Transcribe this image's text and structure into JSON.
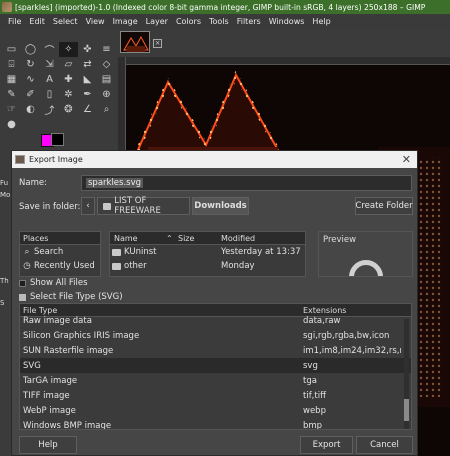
{
  "window": {
    "title": "[sparkles] (imported)-1.0 (Indexed color 8-bit gamma integer, GIMP built-in sRGB, 4 layers) 250x188 – GIMP"
  },
  "menu": [
    "File",
    "Edit",
    "Select",
    "View",
    "Image",
    "Layer",
    "Colors",
    "Tools",
    "Filters",
    "Windows",
    "Help"
  ],
  "toolbox": {
    "tools": [
      "rect-select-icon",
      "ellipse-select-icon",
      "lasso-icon",
      "fuzzy-select-icon",
      "move-icon",
      "align-icon",
      "crop-icon",
      "rotate-icon",
      "scale-icon",
      "shear-icon",
      "flip-icon",
      "perspective-icon",
      "cage-icon",
      "warp-icon",
      "text-icon",
      "heal-icon",
      "bucket-icon",
      "gradient-icon",
      "pencil-icon",
      "brush-icon",
      "eraser-icon",
      "airbrush-icon",
      "ink-icon",
      "clone-icon",
      "smudge-icon",
      "dodge-icon",
      "path-icon",
      "color-picker-icon",
      "measure-icon",
      "zoom-icon",
      "blur-icon"
    ],
    "tool_glyphs": [
      "▭",
      "◯",
      "⌒",
      "✧",
      "✜",
      "≡",
      "⌹",
      "↻",
      "⇲",
      "▱",
      "⇄",
      "◇",
      "▦",
      "∿",
      "A",
      "✚",
      "◣",
      "▤",
      "✎",
      "✐",
      "▯",
      "✲",
      "✒",
      "⊕",
      "☞",
      "◐",
      "⤴",
      "❂",
      "∠",
      "⌕",
      "●"
    ],
    "side_labels": [
      "Fu",
      "Mo",
      "Th",
      "S"
    ],
    "colors": {
      "foreground": "#ff00ff",
      "background": "#000000"
    }
  },
  "dialog": {
    "title": "Export Image",
    "name_label": "Name:",
    "name_value": "sparkles.svg",
    "save_in_label": "Save in folder:",
    "breadcrumb": [
      "LIST OF FREEWARE",
      "Downloads"
    ],
    "create_folder": "Create Folder",
    "places": {
      "header": "Places",
      "items": [
        {
          "icon": "search-icon",
          "label": "Search"
        },
        {
          "icon": "recent-icon",
          "label": "Recently Used"
        }
      ]
    },
    "files": {
      "columns": [
        "Name",
        "Size",
        "Modified"
      ],
      "rows": [
        {
          "name": "KUninst",
          "size": "",
          "modified": "Yesterday at 13:37"
        },
        {
          "name": "other",
          "size": "",
          "modified": "Monday"
        }
      ]
    },
    "preview_label": "Preview",
    "show_all_files": "Show All Files",
    "select_file_type": "Select File Type (SVG)",
    "filetypes": {
      "columns": [
        "File Type",
        "Extensions"
      ],
      "rows": [
        {
          "type": "Raw image data",
          "ext": "data,raw"
        },
        {
          "type": "Silicon Graphics IRIS image",
          "ext": "sgi,rgb,rgba,bw,icon"
        },
        {
          "type": "SUN Rasterfile image",
          "ext": "im1,im8,im24,im32,rs,ras"
        },
        {
          "type": "SVG",
          "ext": "svg"
        },
        {
          "type": "TarGA image",
          "ext": "tga"
        },
        {
          "type": "TIFF image",
          "ext": "tif,tiff"
        },
        {
          "type": "WebP image",
          "ext": "webp"
        },
        {
          "type": "Windows BMP image",
          "ext": "bmp"
        }
      ],
      "selected": "SVG"
    },
    "buttons": {
      "help": "Help",
      "export": "Export",
      "cancel": "Cancel"
    }
  }
}
